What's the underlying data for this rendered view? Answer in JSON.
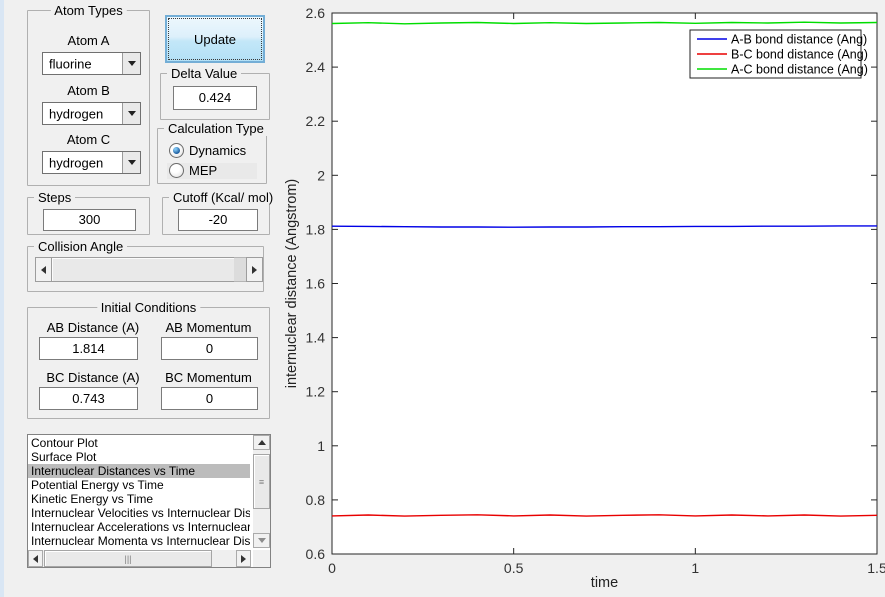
{
  "colors": {
    "window_bg": "#f0f0f0",
    "left_border": "#d9e6f4",
    "selection_bg": "#bcbcbc",
    "update_button_border": "#74aed6"
  },
  "panel": {
    "atom_types": {
      "title": "Atom Types",
      "fields": [
        {
          "label": "Atom A",
          "value": "fluorine"
        },
        {
          "label": "Atom B",
          "value": "hydrogen"
        },
        {
          "label": "Atom C",
          "value": "hydrogen"
        }
      ]
    },
    "update_button_label": "Update",
    "delta_value": {
      "title": "Delta Value",
      "value": "0.424"
    },
    "calculation_type": {
      "title": "Calculation Type",
      "options": [
        {
          "label": "Dynamics",
          "selected": true
        },
        {
          "label": "MEP",
          "selected": false
        }
      ]
    },
    "steps": {
      "title": "Steps",
      "value": "300"
    },
    "cutoff": {
      "title": "Cutoff (Kcal/ mol)",
      "value": "-20"
    },
    "collision_angle": {
      "title": "Collision Angle"
    },
    "initial_conditions": {
      "title": "Initial Conditions",
      "fields": [
        {
          "label": "AB Distance (A)",
          "value": "1.814"
        },
        {
          "label": "AB Momentum",
          "value": "0"
        },
        {
          "label": "BC Distance (A)",
          "value": "0.743"
        },
        {
          "label": "BC Momentum",
          "value": "0"
        }
      ]
    },
    "plot_list": {
      "selected_index": 2,
      "items": [
        "Contour Plot",
        "Surface Plot",
        "Internuclear Distances vs Time",
        "Potential Energy vs Time",
        "Kinetic Energy vs Time",
        "Internuclear Velocities vs Internuclear Distance",
        "Internuclear Accelerations vs Internuclear Distance",
        "Internuclear Momenta vs Internuclear Distance"
      ]
    }
  },
  "chart_data": {
    "type": "line",
    "title": "",
    "xlabel": "time",
    "ylabel": "internuclear distance (Angstrom)",
    "xlim": [
      0,
      1.5
    ],
    "ylim": [
      0.6,
      2.6
    ],
    "xticks": [
      "0",
      "0.5",
      "1",
      "1.5"
    ],
    "yticks": [
      "0.6",
      "0.8",
      "1",
      "1.2",
      "1.4",
      "1.6",
      "1.8",
      "2",
      "2.2",
      "2.4",
      "2.6"
    ],
    "grid": false,
    "legend_position": "top-right",
    "x": [
      0,
      0.1,
      0.2,
      0.3,
      0.4,
      0.5,
      0.6,
      0.7,
      0.8,
      0.9,
      1.0,
      1.1,
      1.2,
      1.3,
      1.4,
      1.5
    ],
    "series": [
      {
        "name": "A-B bond distance (Ang)",
        "color": "#0000e6",
        "values": [
          1.812,
          1.811,
          1.81,
          1.809,
          1.809,
          1.808,
          1.809,
          1.809,
          1.81,
          1.81,
          1.811,
          1.811,
          1.812,
          1.812,
          1.813,
          1.813
        ]
      },
      {
        "name": "B-C bond distance (Ang)",
        "color": "#e80000",
        "values": [
          0.741,
          0.744,
          0.74,
          0.743,
          0.745,
          0.741,
          0.744,
          0.74,
          0.743,
          0.745,
          0.741,
          0.744,
          0.741,
          0.744,
          0.74,
          0.743
        ]
      },
      {
        "name": "A-C bond distance (Ang)",
        "color": "#00dd00",
        "values": [
          2.561,
          2.564,
          2.56,
          2.563,
          2.565,
          2.561,
          2.564,
          2.561,
          2.563,
          2.565,
          2.562,
          2.565,
          2.563,
          2.566,
          2.563,
          2.565
        ]
      }
    ]
  }
}
